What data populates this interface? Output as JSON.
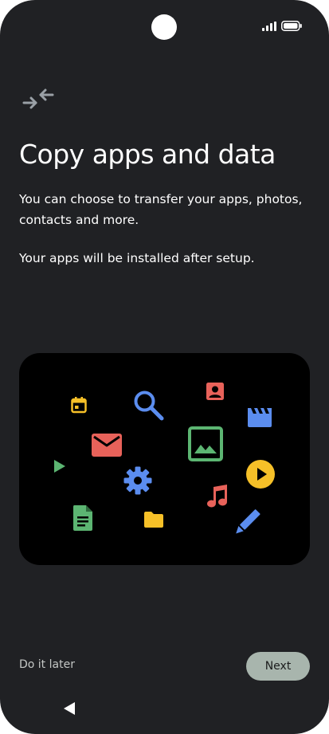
{
  "status_bar": {
    "icons": [
      "camera-cutout",
      "signal-icon",
      "battery-icon"
    ]
  },
  "header": {
    "icon": "transfer-arrows-icon",
    "title": "Copy apps and data"
  },
  "content": {
    "description_1": "You can choose to transfer your apps, photos, contacts and more.",
    "description_2": "Your apps will be installed after setup."
  },
  "illustration": {
    "icons": [
      "calendar-icon",
      "search-icon",
      "contact-icon",
      "video-icon",
      "mail-icon",
      "image-icon",
      "play-icon",
      "settings-icon",
      "play-circle-icon",
      "document-icon",
      "folder-icon",
      "music-icon",
      "pencil-icon"
    ]
  },
  "footer": {
    "skip_label": "Do it later",
    "next_label": "Next"
  },
  "nav_bar": {
    "icons": [
      "back-icon"
    ]
  },
  "colors": {
    "background": "#202124",
    "next_button": "#a8b5ad",
    "google_blue": "#5b8def",
    "google_red": "#e8625a",
    "google_yellow": "#f6c028",
    "google_green": "#5cb572"
  }
}
